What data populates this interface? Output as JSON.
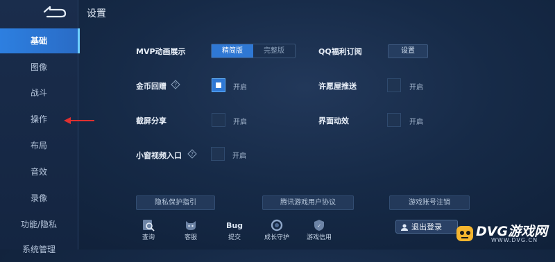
{
  "header": {
    "title": "设置"
  },
  "sidebar": {
    "items": [
      {
        "label": "基础"
      },
      {
        "label": "图像"
      },
      {
        "label": "战斗"
      },
      {
        "label": "操作"
      },
      {
        "label": "布局"
      },
      {
        "label": "音效"
      },
      {
        "label": "录像"
      },
      {
        "label": "功能/隐私"
      },
      {
        "label": "系统管理"
      }
    ]
  },
  "settings": {
    "mvp": {
      "label": "MVP动画展示",
      "options": [
        "精简版",
        "完整版"
      ],
      "selected": "精简版"
    },
    "qq": {
      "label": "QQ福利订阅",
      "button": "设置"
    },
    "coin": {
      "label": "金币回赠",
      "state": "开启",
      "checked": true
    },
    "wish": {
      "label": "许愿屋推送",
      "state": "开启",
      "checked": false
    },
    "screenshot": {
      "label": "截屏分享",
      "state": "开启",
      "checked": false
    },
    "anim": {
      "label": "界面动效",
      "state": "开启",
      "checked": false
    },
    "miniwindow": {
      "label": "小窗视频入口",
      "state": "开启",
      "checked": false
    }
  },
  "footer_buttons": {
    "privacy": "隐私保护指引",
    "agreement": "腾讯游戏用户协议",
    "cancel_account": "游戏账号注销"
  },
  "toolbar": [
    {
      "label": "查询",
      "icon": "query-icon"
    },
    {
      "label": "客服",
      "icon": "customer-service-icon"
    },
    {
      "label": "提交",
      "icon": "bug-icon",
      "badge": "Bug"
    },
    {
      "label": "成长守护",
      "icon": "growth-guard-icon"
    },
    {
      "label": "游戏信用",
      "icon": "game-credit-icon"
    }
  ],
  "logout": {
    "label": "退出登录"
  },
  "watermark": {
    "text": "DVG游戏网",
    "url": "WWW.DVG.CN"
  },
  "colors": {
    "accent": "#2f78d4",
    "background": "#162a47",
    "sidebar": "#1a2d4c"
  }
}
